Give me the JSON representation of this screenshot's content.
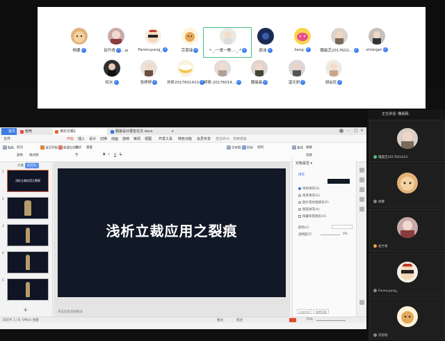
{
  "participants": [
    {
      "name": "杨娜",
      "verified": true
    },
    {
      "name": "赵竹青",
      "verified": true,
      "extra": "…ai"
    },
    {
      "name": "Fanmuyang_",
      "verified": true
    },
    {
      "name": "宗恩瑞",
      "verified": true
    },
    {
      "name": "*-_-一爱一嘢…-_-*",
      "verified": true
    },
    {
      "name": "颜沫",
      "verified": true
    },
    {
      "name": "liang-",
      "verified": true
    },
    {
      "name": "魏晨芝20176O1…",
      "verified": true
    },
    {
      "name": "stronger",
      "verified": true
    },
    {
      "name": "权水",
      "verified": true
    },
    {
      "name": "张婷婷",
      "verified": true
    },
    {
      "name": "刘昕2017601410",
      "verified": true
    },
    {
      "name": "郝倩-20176014…",
      "verified": true
    },
    {
      "name": "魏晨晨",
      "verified": true
    },
    {
      "name": "温天妍",
      "verified": true
    },
    {
      "name": "胡会旺",
      "verified": true
    }
  ],
  "wps": {
    "tabs": [
      "首页",
      "稻壳",
      "演示文稿1",
      "服装设计报告论文.docx"
    ],
    "tab_add": "+",
    "menu": [
      "文件",
      "开始",
      "插入",
      "设计",
      "切换",
      "动画",
      "放映",
      "审阅",
      "视图",
      "开发工具",
      "特色功能",
      "会员专享",
      "查找命令、搜索模板"
    ],
    "ribbon": [
      "粘贴",
      "剪切",
      "复制",
      "格式刷",
      "当页开始",
      "新建幻灯片",
      "版式",
      "节",
      "重置",
      "B",
      "I",
      "U",
      "S",
      "文本框",
      "形状",
      "排列",
      "查找",
      "替换",
      "选择"
    ],
    "pane_tabs": [
      "大纲",
      "幻灯片"
    ],
    "thumbnails": [
      {
        "num": "1",
        "title": "浅析立裁应用之裂痕"
      },
      {
        "num": "2",
        "title": ""
      },
      {
        "num": "3",
        "title": ""
      },
      {
        "num": "4",
        "title": ""
      },
      {
        "num": "5",
        "title": ""
      }
    ],
    "add_slide": "+",
    "slide_title": "浅析立裁应用之裂痕",
    "notes_placeholder": "单击此处添加备注",
    "properties": {
      "header": "对象属性 ▾",
      "section": "填充",
      "options": [
        "纯色填充(S)",
        "渐变填充(G)",
        "图片或纹理填充(P)",
        "图案填充(A)",
        "隐藏背景图形(H)"
      ],
      "color_label": "颜色(C)",
      "transparency_label": "透明度(T)",
      "transparency_value": "0%",
      "apply_all": "全部应用",
      "reset_bg": "重置背景"
    },
    "status": {
      "slide_info": "幻灯片 1 / 8",
      "theme": "Office 主题",
      "notes_btn": "备注",
      "comment_btn": "批注",
      "zoom": "75%"
    }
  },
  "meeting": {
    "speaking_label": "正在讲话: 魏晨晨;",
    "tiles": [
      {
        "name": "魏晨芝2017601410"
      },
      {
        "name": "杨娜"
      },
      {
        "name": "赵竹青"
      },
      {
        "name": "Fanmuyang_"
      },
      {
        "name": "宗恩瑞"
      }
    ]
  },
  "colors": {
    "accent_red": "#d4442d",
    "badge_blue": "#3d7ff0",
    "slide_bg": "#111826",
    "selected_border": "#4ec082"
  }
}
